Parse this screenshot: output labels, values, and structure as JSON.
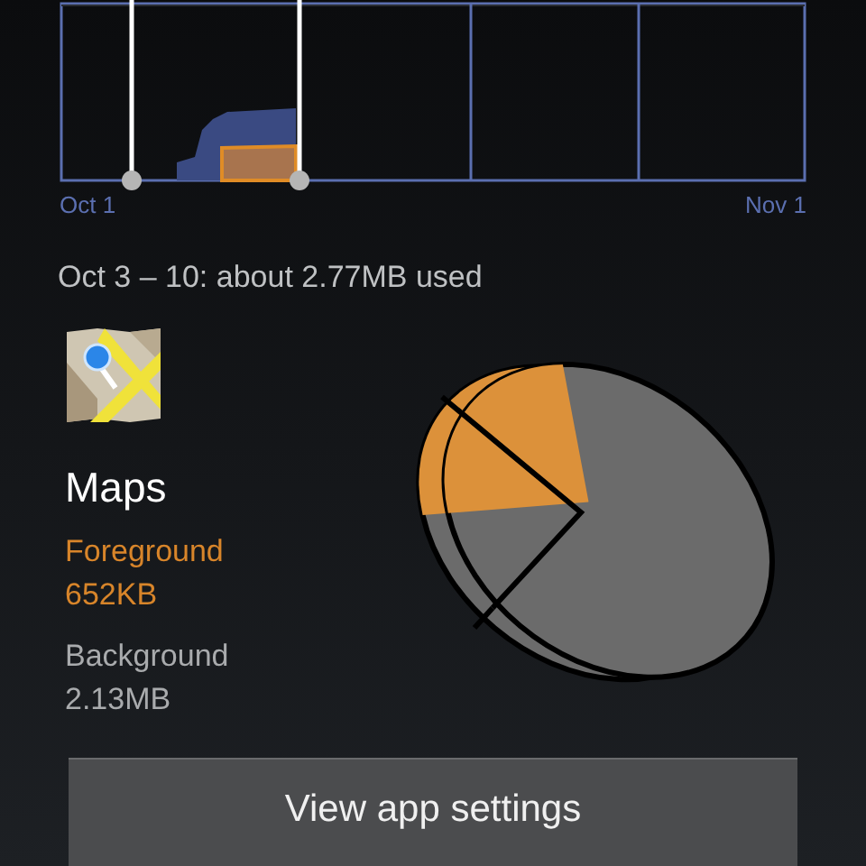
{
  "chart": {
    "start_label": "Oct 1",
    "end_label": "Nov 1"
  },
  "summary": "Oct 3 – 10: about 2.77MB used",
  "app": {
    "name": "Maps"
  },
  "usage": [
    {
      "kind": "foreground",
      "label": "Foreground",
      "value": "652KB"
    },
    {
      "kind": "background",
      "label": "Background",
      "value": "2.13MB"
    }
  ],
  "button": "View app settings"
}
